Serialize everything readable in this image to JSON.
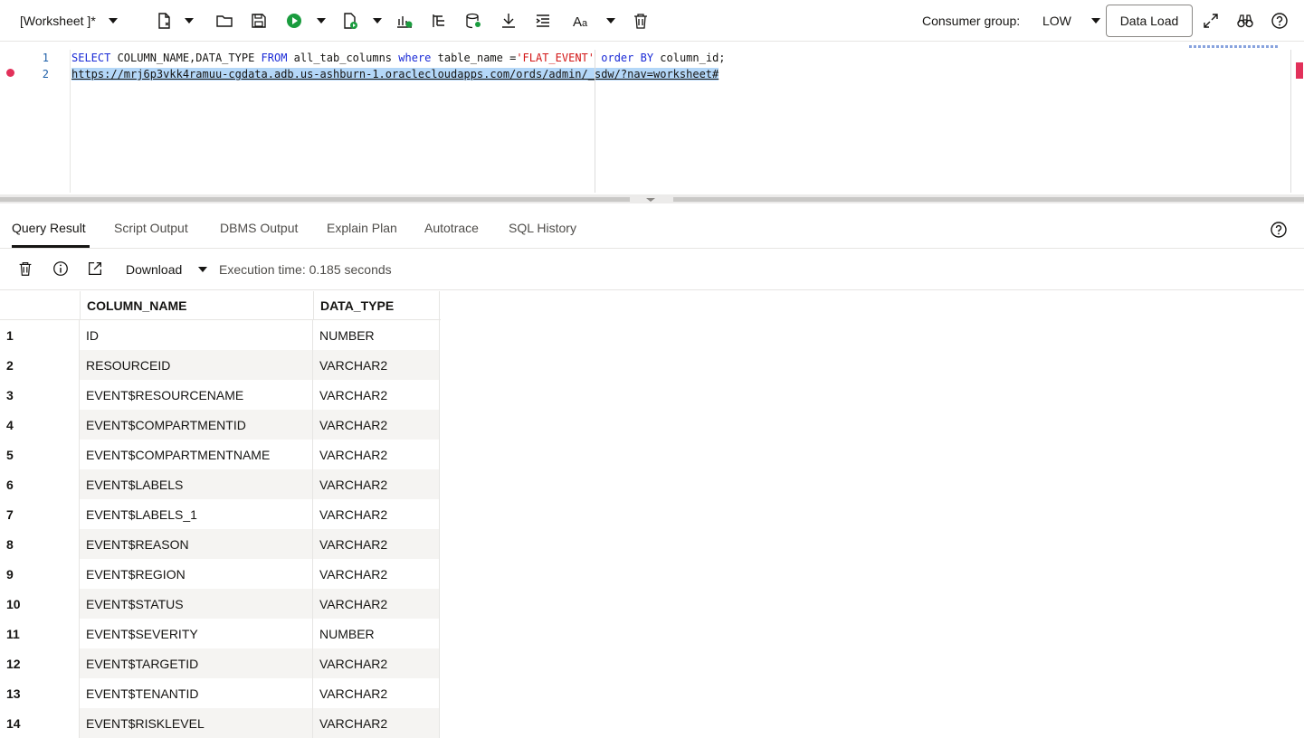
{
  "toolbar": {
    "worksheet_label": "[Worksheet ]*",
    "icons": [
      "new-worksheet-icon",
      "open-icon",
      "save-icon",
      "run-statement-icon",
      "run-script-icon",
      "explain-plan-icon",
      "autotrace-icon",
      "sql-tuning-icon",
      "download-icon",
      "format-icon",
      "case-icon",
      "clear-icon"
    ],
    "consumer_group_label": "Consumer group:",
    "consumer_group_value": "LOW",
    "data_load_label": "Data Load",
    "accent_run": "#1a9c3e"
  },
  "editor": {
    "line_numbers": [
      "1",
      "2"
    ],
    "line1": {
      "kw_select": "SELECT",
      "t1": " COLUMN_NAME,DATA_TYPE ",
      "kw_from": "FROM",
      "t2": " all_tab_columns ",
      "kw_where": "where",
      "t3": " table_name =",
      "str": "'FLAT_EVENT'",
      "t4": " ",
      "kw_order": "order",
      "t5": " ",
      "kw_by": "BY",
      "t6": " column_id;"
    },
    "line2": "https://mrj6p3vkk4ramuu-cgdata.adb.us-ashburn-1.oraclecloudapps.com/ords/admin/_sdw/?nav=worksheet#"
  },
  "result_tabs": [
    "Query Result",
    "Script Output",
    "DBMS Output",
    "Explain Plan",
    "Autotrace",
    "SQL History"
  ],
  "result_toolbar": {
    "download_label": "Download",
    "execution_time": "Execution time: 0.185 seconds"
  },
  "grid": {
    "columns": [
      "COLUMN_NAME",
      "DATA_TYPE"
    ],
    "rows": [
      [
        "1",
        "ID",
        "NUMBER"
      ],
      [
        "2",
        "RESOURCEID",
        "VARCHAR2"
      ],
      [
        "3",
        "EVENT$RESOURCENAME",
        "VARCHAR2"
      ],
      [
        "4",
        "EVENT$COMPARTMENTID",
        "VARCHAR2"
      ],
      [
        "5",
        "EVENT$COMPARTMENTNAME",
        "VARCHAR2"
      ],
      [
        "6",
        "EVENT$LABELS",
        "VARCHAR2"
      ],
      [
        "7",
        "EVENT$LABELS_1",
        "VARCHAR2"
      ],
      [
        "8",
        "EVENT$REASON",
        "VARCHAR2"
      ],
      [
        "9",
        "EVENT$REGION",
        "VARCHAR2"
      ],
      [
        "10",
        "EVENT$STATUS",
        "VARCHAR2"
      ],
      [
        "11",
        "EVENT$SEVERITY",
        "NUMBER"
      ],
      [
        "12",
        "EVENT$TARGETID",
        "VARCHAR2"
      ],
      [
        "13",
        "EVENT$TENANTID",
        "VARCHAR2"
      ],
      [
        "14",
        "EVENT$RISKLEVEL",
        "VARCHAR2"
      ]
    ]
  }
}
